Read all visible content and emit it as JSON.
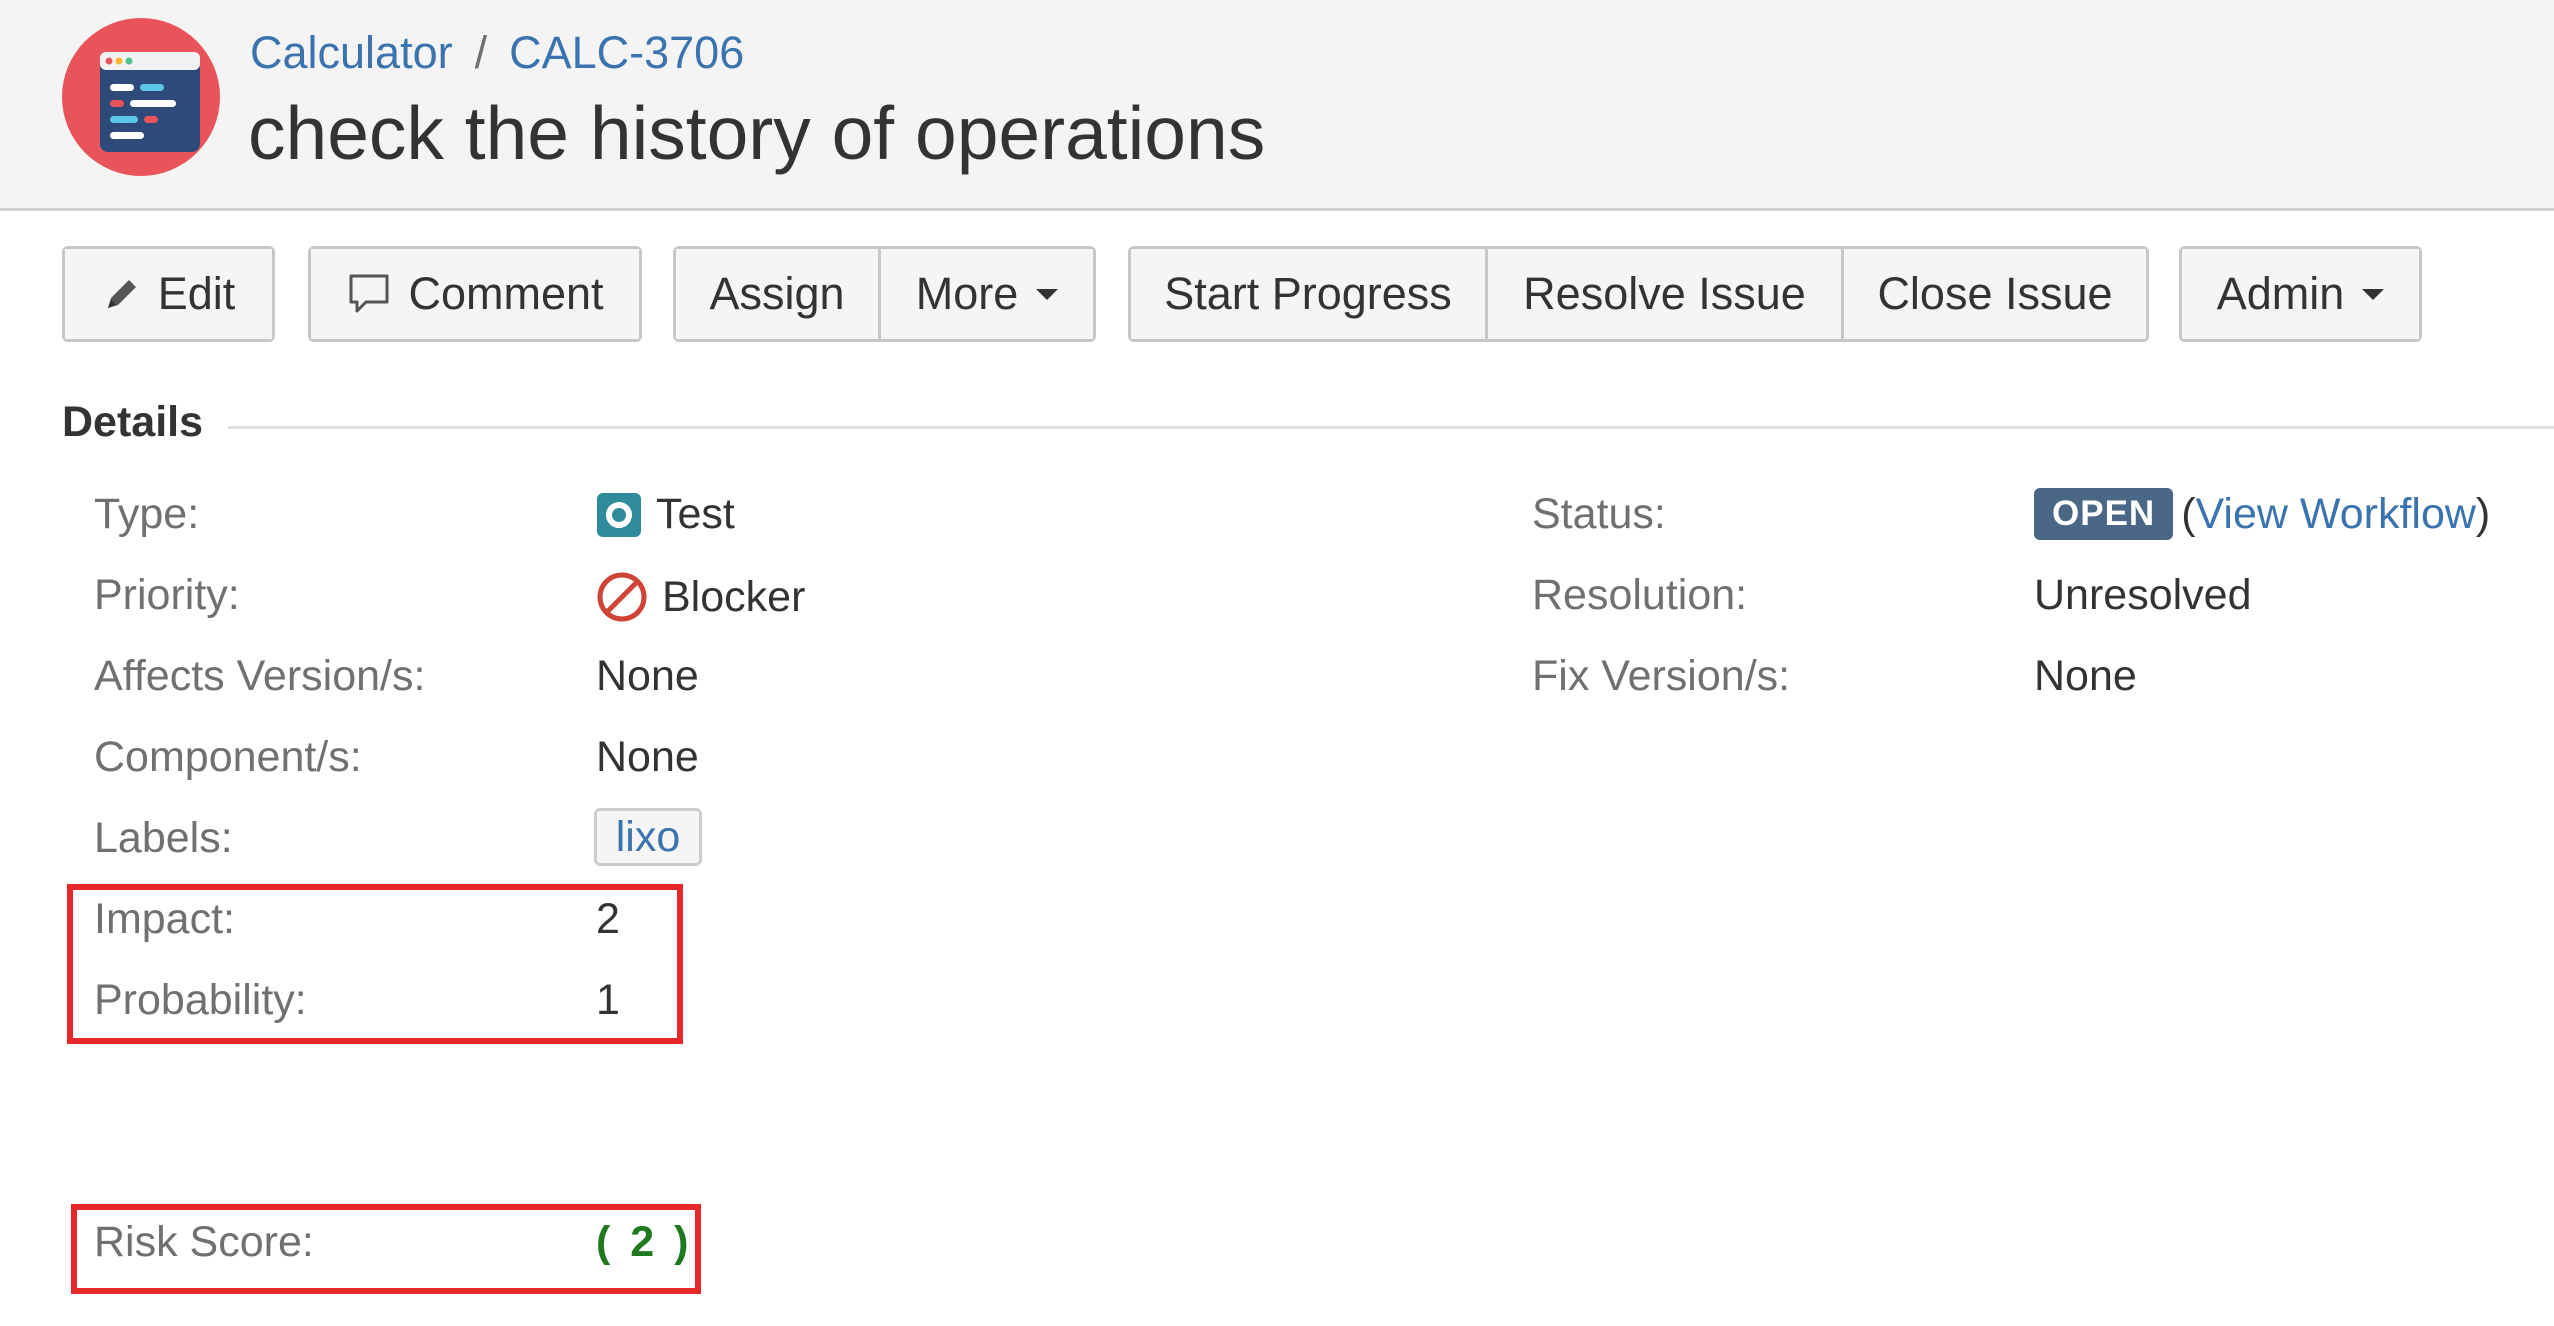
{
  "breadcrumb": {
    "project": "Calculator",
    "separator": "/",
    "issue_key": "CALC-3706"
  },
  "issue": {
    "title": "check the history of operations"
  },
  "toolbar": {
    "edit": "Edit",
    "comment": "Comment",
    "assign": "Assign",
    "more": "More",
    "start_progress": "Start Progress",
    "resolve_issue": "Resolve Issue",
    "close_issue": "Close Issue",
    "admin": "Admin"
  },
  "details": {
    "heading": "Details",
    "left": {
      "type_label": "Type:",
      "type_value": "Test",
      "priority_label": "Priority:",
      "priority_value": "Blocker",
      "affects_label": "Affects Version/s:",
      "affects_value": "None",
      "component_label": "Component/s:",
      "component_value": "None",
      "labels_label": "Labels:",
      "labels_value": "lixo",
      "impact_label": "Impact:",
      "impact_value": "2",
      "probability_label": "Probability:",
      "probability_value": "1",
      "risk_label": "Risk Score:",
      "risk_value": "( 2 )"
    },
    "right": {
      "status_label": "Status:",
      "status_value": "OPEN",
      "paren_open": "(",
      "workflow_link": "View Workflow",
      "paren_close": ")",
      "resolution_label": "Resolution:",
      "resolution_value": "Unresolved",
      "fix_label": "Fix Version/s:",
      "fix_value": "None"
    }
  },
  "colors": {
    "link": "#3b73af",
    "status_lozenge": "#4a6785",
    "risk_score": "#1f7a1f",
    "highlight": "#e8272b",
    "blocker": "#d04437",
    "test_type": "#2e8b9a"
  },
  "icons": [
    "project-avatar-icon",
    "pencil-icon",
    "comment-icon",
    "test-type-icon",
    "blocker-icon",
    "chevron-down-icon"
  ]
}
